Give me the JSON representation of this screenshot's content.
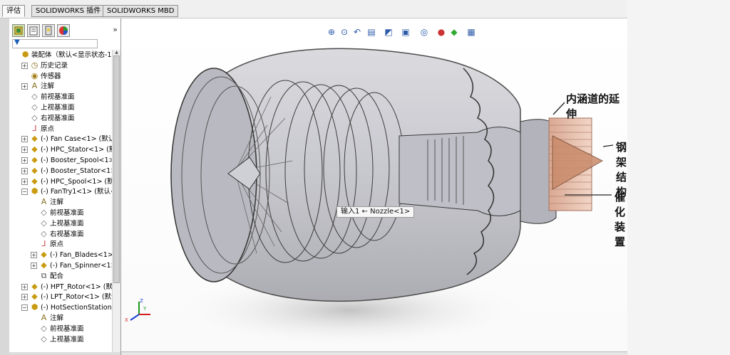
{
  "tabs": [
    {
      "label": "评估",
      "active": true
    },
    {
      "label": "SOLIDWORKS 插件",
      "active": false
    },
    {
      "label": "SOLIDWORKS MBD",
      "active": false
    }
  ],
  "panel": {
    "tab_icons": [
      "feature-manager-icon",
      "property-manager-icon",
      "configuration-manager-icon",
      "display-manager-icon"
    ],
    "more_label": "»"
  },
  "tree": [
    {
      "label": "装配体（默认<显示状态-1>",
      "level": 0,
      "icon": "assembly-icon",
      "expander": ""
    },
    {
      "label": "历史记录",
      "level": 1,
      "icon": "history-icon",
      "expander": "+"
    },
    {
      "label": "传感器",
      "level": 1,
      "icon": "sensor-icon",
      "expander": ""
    },
    {
      "label": "注解",
      "level": 1,
      "icon": "annotation-icon",
      "expander": "+"
    },
    {
      "label": "前视基准面",
      "level": 1,
      "icon": "plane-icon",
      "expander": ""
    },
    {
      "label": "上视基准面",
      "level": 1,
      "icon": "plane-icon",
      "expander": ""
    },
    {
      "label": "右视基准面",
      "level": 1,
      "icon": "plane-icon",
      "expander": ""
    },
    {
      "label": "原点",
      "level": 1,
      "icon": "origin-icon",
      "expander": ""
    },
    {
      "label": "(-) Fan Case<1> (默认<",
      "level": 1,
      "icon": "part-icon",
      "expander": "+"
    },
    {
      "label": "(-) HPC_Stator<1> (默认",
      "level": 1,
      "icon": "part-icon",
      "expander": "+"
    },
    {
      "label": "(-) Booster_Spool<1>",
      "level": 1,
      "icon": "part-icon",
      "expander": "+"
    },
    {
      "label": "(-) Booster_Stator<1>",
      "level": 1,
      "icon": "part-icon",
      "expander": "+"
    },
    {
      "label": "(-) HPC_Spool<1> (默认",
      "level": 1,
      "icon": "part-icon",
      "expander": "+"
    },
    {
      "label": "(-) FanTry1<1> (默认<显",
      "level": 1,
      "icon": "subassembly-icon",
      "expander": "−"
    },
    {
      "label": "注解",
      "level": 2,
      "icon": "annotation-icon",
      "expander": ""
    },
    {
      "label": "前视基准面",
      "level": 2,
      "icon": "plane-icon",
      "expander": ""
    },
    {
      "label": "上视基准面",
      "level": 2,
      "icon": "plane-icon",
      "expander": ""
    },
    {
      "label": "右视基准面",
      "level": 2,
      "icon": "plane-icon",
      "expander": ""
    },
    {
      "label": "原点",
      "level": 2,
      "icon": "origin-icon",
      "expander": ""
    },
    {
      "label": "(-) Fan_Blades<1> (",
      "level": 2,
      "icon": "part-icon",
      "expander": "+"
    },
    {
      "label": "(-) Fan_Spinner<1>",
      "level": 2,
      "icon": "part-icon",
      "expander": "+"
    },
    {
      "label": "配合",
      "level": 2,
      "icon": "mates-icon",
      "expander": ""
    },
    {
      "label": "(-) HPT_Rotor<1> (默认",
      "level": 1,
      "icon": "part-icon",
      "expander": "+"
    },
    {
      "label": "(-) LPT_Rotor<1> (默认",
      "level": 1,
      "icon": "part-icon",
      "expander": "+"
    },
    {
      "label": "(-) HotSectionStationar",
      "level": 1,
      "icon": "subassembly-icon",
      "expander": "−"
    },
    {
      "label": "注解",
      "level": 2,
      "icon": "annotation-icon",
      "expander": ""
    },
    {
      "label": "前视基准面",
      "level": 2,
      "icon": "plane-icon",
      "expander": ""
    },
    {
      "label": "上视基准面",
      "level": 2,
      "icon": "plane-icon",
      "expander": ""
    }
  ],
  "viewport": {
    "heads_up_icons": [
      "zoom-to-fit-icon",
      "zoom-area-icon",
      "previous-view-icon",
      "section-view-icon",
      "view-orientation-icon",
      "display-style-icon",
      "hide-show-icon",
      "appearance-icon",
      "scene-icon",
      "view-settings-icon"
    ],
    "callouts": [
      "内涵道的延伸",
      "钢架结构",
      "催化装置"
    ],
    "tooltip": "输入1 ← Nozzle<1>",
    "triad": {
      "x": "X",
      "y": "Y",
      "z": "Z"
    }
  }
}
